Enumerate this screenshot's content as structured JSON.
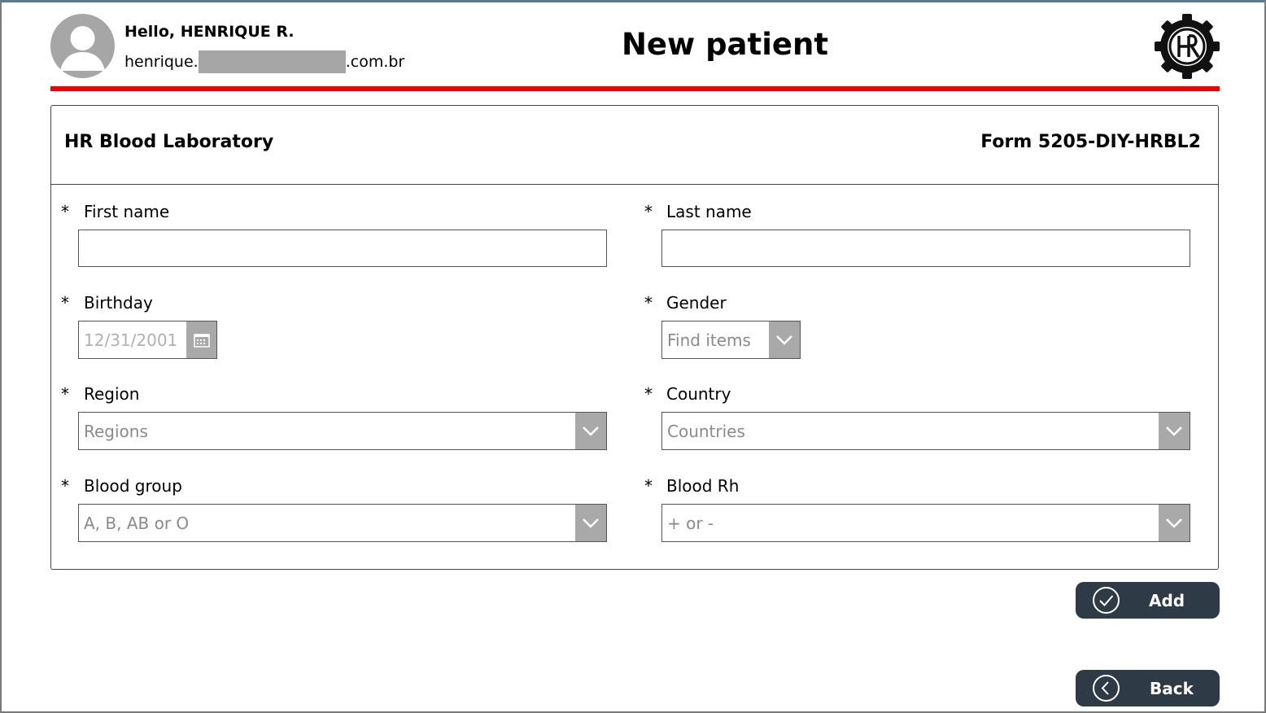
{
  "header": {
    "greeting": "Hello, HENRIQUE R.",
    "email_prefix": "henrique.",
    "email_suffix": ".com.br",
    "title": "New patient"
  },
  "form": {
    "lab_name": "HR Blood Laboratory",
    "form_code": "Form 5205-DIY-HRBL2",
    "required_marker": "*",
    "fields": {
      "first_name": {
        "label": "First name",
        "value": ""
      },
      "last_name": {
        "label": "Last name",
        "value": ""
      },
      "birthday": {
        "label": "Birthday",
        "placeholder": "12/31/2001"
      },
      "gender": {
        "label": "Gender",
        "placeholder": "Find items"
      },
      "region": {
        "label": "Region",
        "placeholder": "Regions"
      },
      "country": {
        "label": "Country",
        "placeholder": "Countries"
      },
      "blood_group": {
        "label": "Blood group",
        "placeholder": "A, B, AB or O"
      },
      "blood_rh": {
        "label": "Blood Rh",
        "placeholder": "+ or -"
      }
    }
  },
  "buttons": {
    "add": "Add",
    "back": "Back"
  },
  "colors": {
    "accent_rule": "#f00000",
    "button_bg": "#2e3a45",
    "dropdown_arrow_bg": "#a9a9a9",
    "placeholder_text": "#8a8a8a"
  }
}
